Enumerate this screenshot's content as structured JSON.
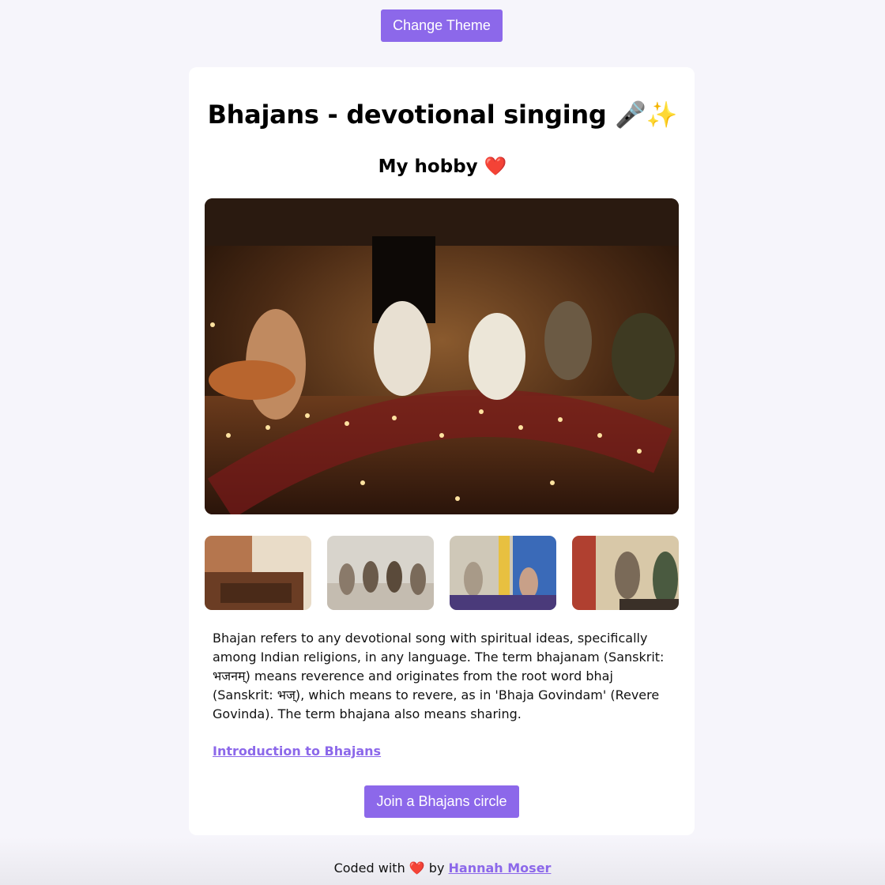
{
  "header": {
    "theme_button_label": "Change Theme"
  },
  "card": {
    "title": "Bhajans - devotional singing 🎤✨",
    "subtitle": "My hobby ❤️",
    "description": "Bhajan refers to any devotional song with spiritual ideas, specifically among Indian religions, in any language. The term bhajanam (Sanskrit: भजनम्) means reverence and originates from the root word bhaj (Sanskrit: भज्), which means to revere, as in 'Bhaja Govindam' (Revere Govinda). The term bhajana also means sharing.",
    "link_label": "Introduction to Bhajans",
    "join_button_label": "Join a Bhajans circle"
  },
  "footer": {
    "prefix": "Coded with ❤️ by",
    "author": "Hannah Moser"
  },
  "colors": {
    "accent": "#8c68ea",
    "background": "#f6f5fb",
    "card": "#ffffff"
  }
}
